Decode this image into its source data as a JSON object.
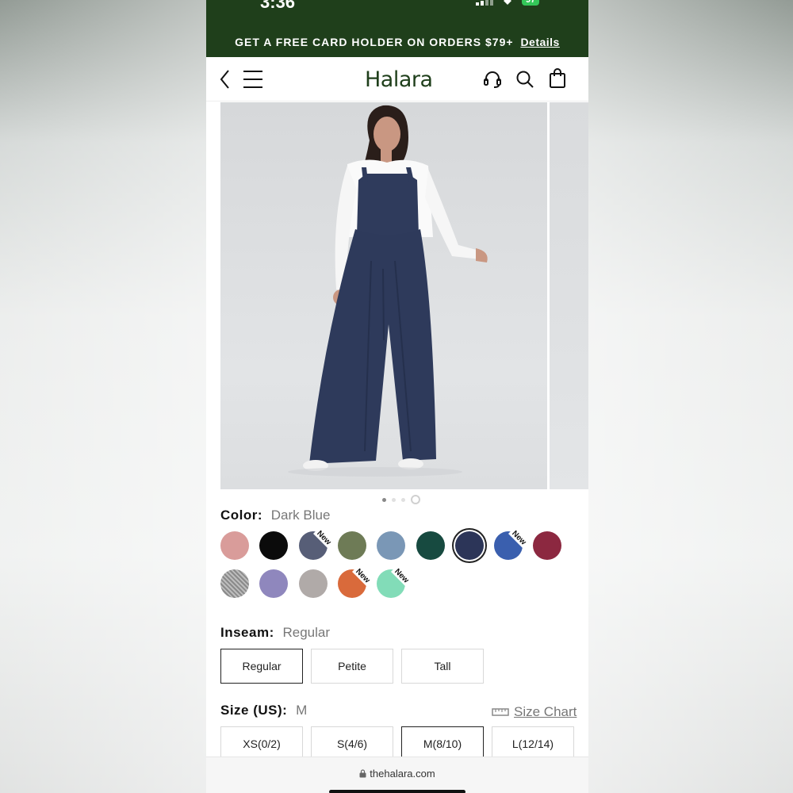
{
  "status_bar": {
    "time": "3:36",
    "battery": "97"
  },
  "promo": {
    "text": "GET A FREE CARD HOLDER ON ORDERS $79+",
    "link": "Details"
  },
  "header": {
    "logo": "Halara"
  },
  "gallery": {
    "page_count": 4,
    "current_page": 1
  },
  "color": {
    "label": "Color:",
    "selected": "Dark Blue",
    "swatches": [
      {
        "hex": "#d99c9a",
        "new": false
      },
      {
        "hex": "#0b0b0b",
        "new": false
      },
      {
        "hex": "#575e77",
        "new": true,
        "new_label": "New"
      },
      {
        "hex": "#6e7b56",
        "new": false
      },
      {
        "hex": "#7a97b6",
        "new": false
      },
      {
        "hex": "#174a40",
        "new": false
      },
      {
        "hex": "#2c3558",
        "new": false,
        "selected": true
      },
      {
        "hex": "#3a5fae",
        "new": true,
        "new_label": "New"
      },
      {
        "hex": "#8c2840",
        "new": false
      },
      {
        "hex": "#9a9a9a",
        "new": false,
        "pattern": "heather"
      },
      {
        "hex": "#8f87bd",
        "new": false
      },
      {
        "hex": "#b0aaa8",
        "new": false
      },
      {
        "hex": "#d96a3b",
        "new": true,
        "new_label": "New"
      },
      {
        "hex": "#82dcb8",
        "new": true,
        "new_label": "New"
      }
    ]
  },
  "inseam": {
    "label": "Inseam:",
    "selected": "Regular",
    "options": [
      "Regular",
      "Petite",
      "Tall"
    ]
  },
  "size": {
    "label": "Size (US):",
    "selected": "M",
    "chart_link": "Size Chart",
    "options": [
      "XS(0/2)",
      "S(4/6)",
      "M(8/10)",
      "L(12/14)"
    ]
  },
  "browser": {
    "url": "thehalara.com"
  }
}
